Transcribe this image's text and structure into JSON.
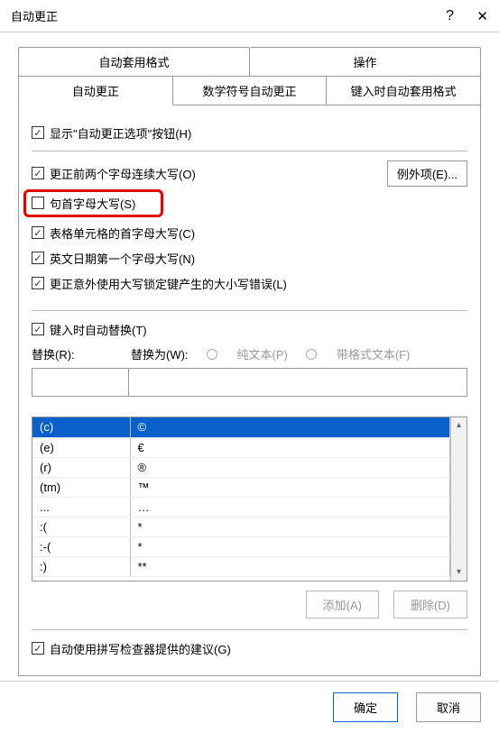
{
  "titlebar": {
    "title": "自动更正",
    "help": "?",
    "close": "✕"
  },
  "tabs": {
    "row1": [
      "自动套用格式",
      "操作"
    ],
    "row2": [
      "自动更正",
      "数学符号自动更正",
      "键入时自动套用格式"
    ]
  },
  "checkboxes": {
    "show_button": "显示\"自动更正选项\"按钮(H)",
    "two_initial_caps": "更正前两个字母连续大写(O)",
    "sentence_first_cap": "句首字母大写(S)",
    "table_cell_cap": "表格单元格的首字母大写(C)",
    "english_date_cap": "英文日期第一个字母大写(N)",
    "caps_lock": "更正意外使用大写锁定键产生的大小写错误(L)",
    "replace_typing": "键入时自动替换(T)",
    "spell_checker": "自动使用拼写检查器提供的建议(G)"
  },
  "exceptions_label": "例外项(E)...",
  "replace_section": {
    "replace_label": "替换(R):",
    "with_label": "替换为(W):",
    "plain_text": "纯文本(P)",
    "formatted_text": "带格式文本(F)"
  },
  "replace_table": {
    "rows": [
      {
        "from": "(c)",
        "to": "©"
      },
      {
        "from": "(e)",
        "to": "€"
      },
      {
        "from": "(r)",
        "to": "®"
      },
      {
        "from": "(tm)",
        "to": "™"
      },
      {
        "from": "...",
        "to": "…"
      },
      {
        "from": ":(",
        "to": "*"
      },
      {
        "from": ":-(",
        "to": "*"
      },
      {
        "from": ":)",
        "to": "**"
      }
    ]
  },
  "list_buttons": {
    "add": "添加(A)",
    "delete": "删除(D)"
  },
  "footer": {
    "ok": "确定",
    "cancel": "取消"
  }
}
